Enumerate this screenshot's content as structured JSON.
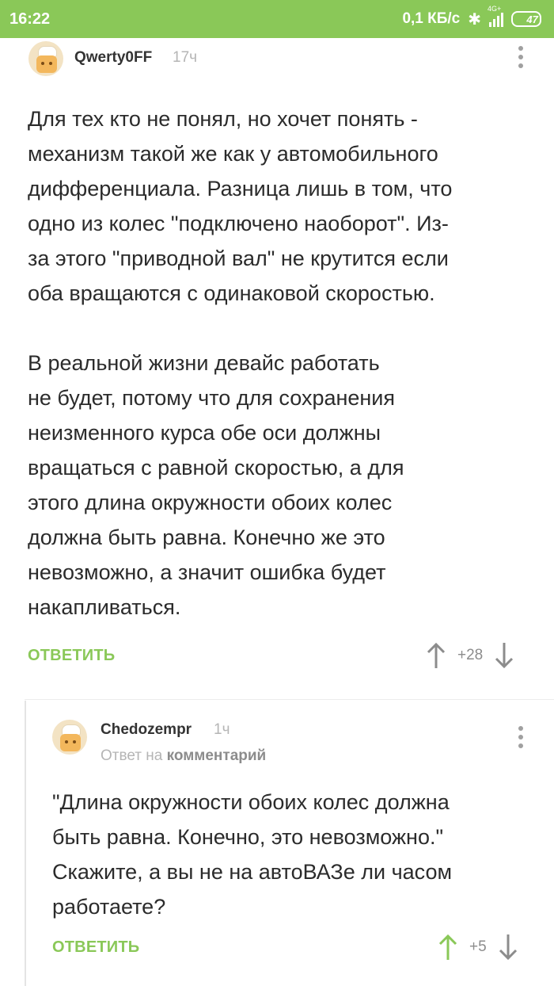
{
  "status_bar": {
    "time": "16:22",
    "speed": "0,1 КБ/с",
    "network": "4G+",
    "battery": "47",
    "icons": [
      "bluetooth-icon",
      "signal-icon",
      "battery-icon"
    ]
  },
  "comment1": {
    "username": "Qwerty0FF",
    "time": "17ч",
    "paragraph1_lines": [
      "Для тех кто не понял, но хочет понять -",
      "механизм такой же как у автомобильного",
      "дифференциала. Разница лишь в том, что",
      "одно из колес \"подключено наоборот\". Из-",
      "за этого \"приводной вал\" не крутится если",
      "оба вращаются с одинаковой скоростью."
    ],
    "paragraph2_lines": [
      "В реальной жизни девайс работать",
      "не будет, потому что для сохранения",
      "неизменного курса обе оси должны",
      "вращаться с равной скоростью, а для",
      "этого длина окружности обоих колес",
      "должна быть равна. Конечно же это",
      "невозможно, а значит ошибка будет",
      "накапливаться."
    ],
    "reply_label": "ОТВЕТИТЬ",
    "rating": "+28"
  },
  "comment2": {
    "username": "Chedozempr",
    "time": "1ч",
    "reply_prefix": "Ответ на",
    "reply_target": "комментарий",
    "text_lines": [
      "\"Длина окружности обоих колес должна",
      "быть равна. Конечно, это невозможно.\"",
      "Скажите, а вы не на автоВАЗе ли часом",
      "работаете?"
    ],
    "reply_label": "ОТВЕТИТЬ",
    "rating": "+5",
    "upvoted": true
  },
  "colors": {
    "accent": "#8ac858",
    "text": "#2b2b2b",
    "muted": "#b5b5b5"
  }
}
